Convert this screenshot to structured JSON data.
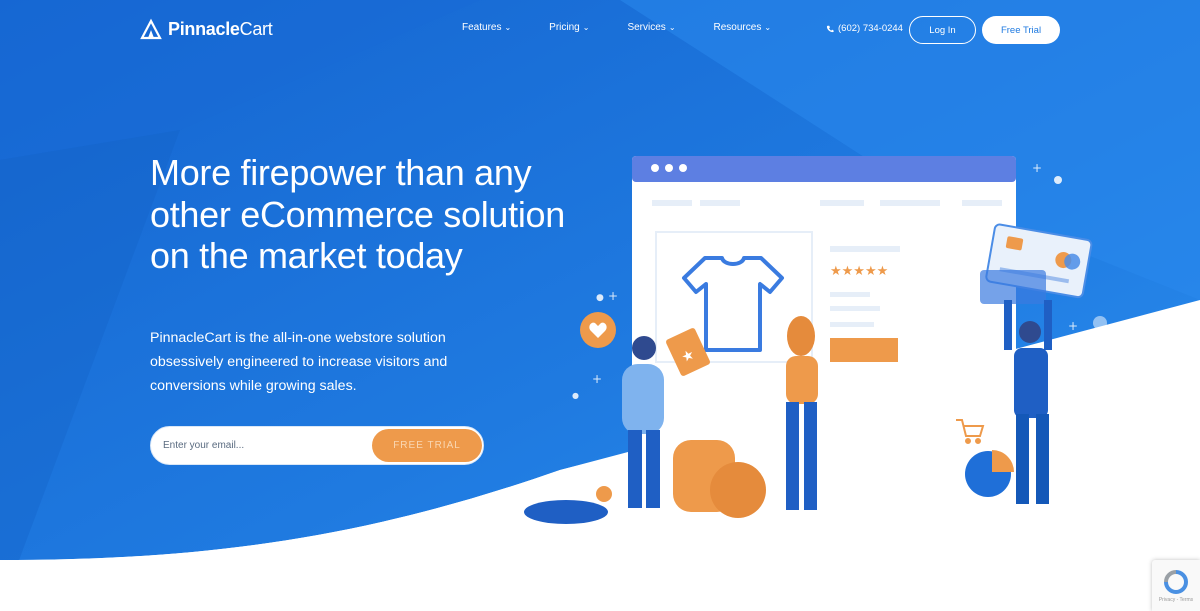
{
  "brand": {
    "name_bold": "Pinnacle",
    "name_light": "Cart"
  },
  "nav": {
    "items": [
      {
        "label": "Features"
      },
      {
        "label": "Pricing"
      },
      {
        "label": "Services"
      },
      {
        "label": "Resources"
      }
    ]
  },
  "header": {
    "phone": "(602) 734-0244",
    "login_label": "Log In",
    "trial_label": "Free Trial"
  },
  "hero": {
    "title": "More firepower than any other eCommerce solution on the market today",
    "subtitle": "PinnacleCart is the all-in-one webstore solution obsessively engineered to increase visitors and conversions while growing sales.",
    "email_placeholder": "Enter your email...",
    "cta_label": "FREE TRIAL"
  },
  "recaptcha": {
    "footer": "Privacy - Terms"
  },
  "colors": {
    "primary_blue": "#1f7ae0",
    "dark_blue": "#1462c7",
    "accent_orange": "#ee9a4b",
    "white": "#ffffff"
  },
  "icons": [
    "logo-mountain-icon",
    "chevron-down-icon",
    "phone-icon",
    "tshirt-icon",
    "heart-icon",
    "star-icon",
    "cart-icon",
    "pie-chart-icon",
    "credit-card-icon",
    "recaptcha-icon"
  ]
}
